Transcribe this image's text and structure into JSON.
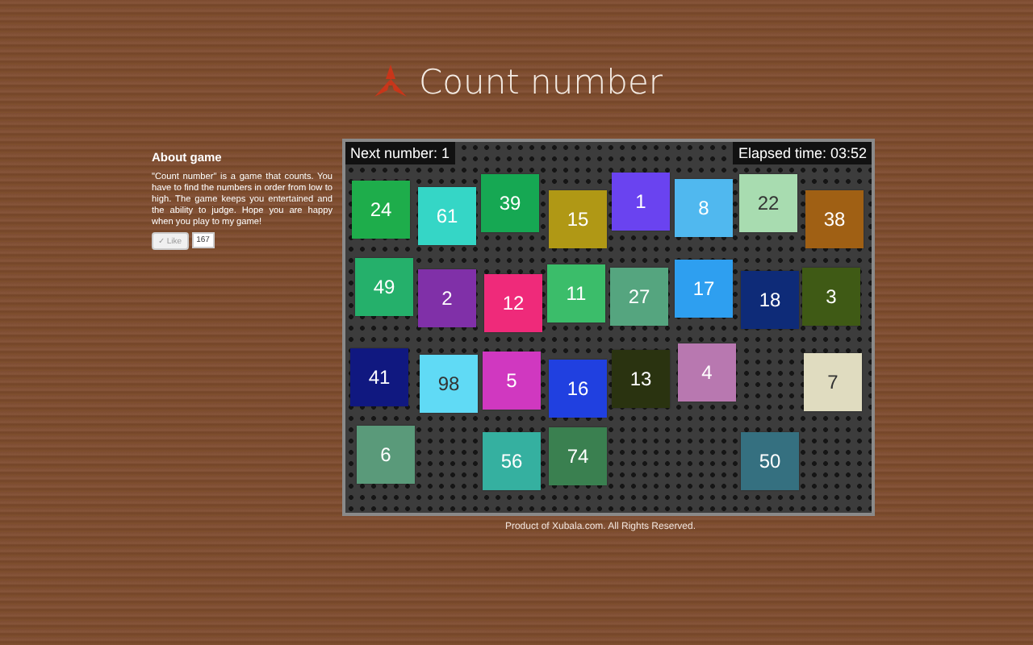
{
  "header": {
    "title": "Count number"
  },
  "about": {
    "heading": "About game",
    "text": "\"Count number\" is a game that counts. You have to find the numbers in order from low to high. The game keeps you entertained and the ability to judge. Hope you are happy when you play to my game!",
    "like_button": "✓ Like",
    "like_count": "167"
  },
  "game": {
    "next_number": "Next number: 1",
    "elapsed_time": "Elapsed time: 03:52",
    "tiles": [
      {
        "number": "24",
        "color": "#1ead4b"
      },
      {
        "number": "61",
        "color": "#35d6c6"
      },
      {
        "number": "39",
        "color": "#16a853"
      },
      {
        "number": "15",
        "color": "#b09815"
      },
      {
        "number": "1",
        "color": "#6a43f0"
      },
      {
        "number": "8",
        "color": "#50b8ef"
      },
      {
        "number": "22",
        "color": "#a8dcb0"
      },
      {
        "number": "38",
        "color": "#a06014"
      },
      {
        "number": "49",
        "color": "#25b06b"
      },
      {
        "number": "2",
        "color": "#8030a8"
      },
      {
        "number": "12",
        "color": "#ef2a7a"
      },
      {
        "number": "11",
        "color": "#3bbd6a"
      },
      {
        "number": "27",
        "color": "#55a57f"
      },
      {
        "number": "17",
        "color": "#2e9ff0"
      },
      {
        "number": "18",
        "color": "#0e2b78"
      },
      {
        "number": "3",
        "color": "#3f5a15"
      },
      {
        "number": "41",
        "color": "#101880"
      },
      {
        "number": "98",
        "color": "#60daf5"
      },
      {
        "number": "5",
        "color": "#d038c0"
      },
      {
        "number": "16",
        "color": "#2040e0"
      },
      {
        "number": "13",
        "color": "#2a3310"
      },
      {
        "number": "4",
        "color": "#b878b0"
      },
      {
        "number": "7",
        "color": "#e0dcc0"
      },
      {
        "number": "6",
        "color": "#5a9a7a"
      },
      {
        "number": "56",
        "color": "#35b0a0"
      },
      {
        "number": "74",
        "color": "#3a8050"
      },
      {
        "number": "50",
        "color": "#357080"
      }
    ]
  },
  "footer": {
    "text": "Product of Xubala.com. All Rights Reserved."
  }
}
